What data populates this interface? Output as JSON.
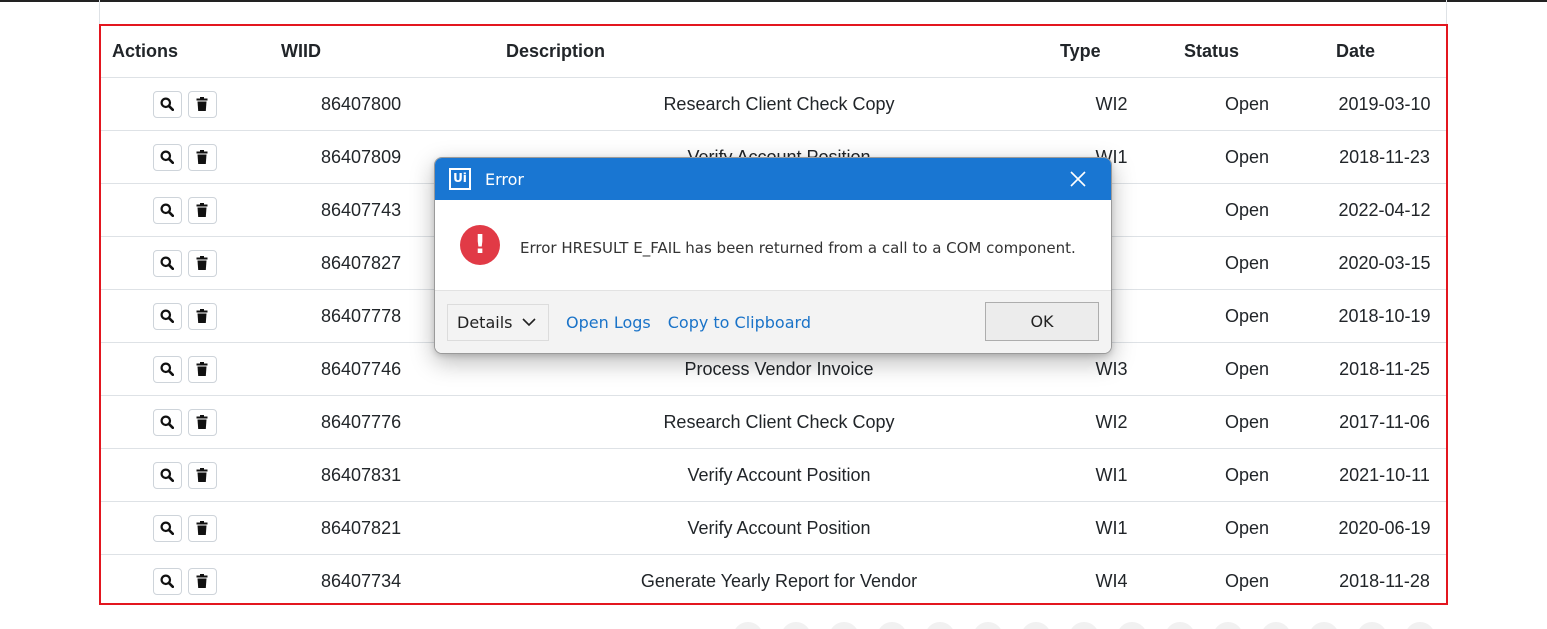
{
  "table": {
    "headers": {
      "actions": "Actions",
      "wiid": "WIID",
      "description": "Description",
      "type": "Type",
      "status": "Status",
      "date": "Date"
    },
    "rows": [
      {
        "wiid": "86407800",
        "description": "Research Client Check Copy",
        "type": "WI2",
        "status": "Open",
        "date": "2019-03-10"
      },
      {
        "wiid": "86407809",
        "description": "Verify Account Position",
        "type": "WI1",
        "status": "Open",
        "date": "2018-11-23"
      },
      {
        "wiid": "86407743",
        "description": "",
        "type": "",
        "status": "Open",
        "date": "2022-04-12"
      },
      {
        "wiid": "86407827",
        "description": "",
        "type": "",
        "status": "Open",
        "date": "2020-03-15"
      },
      {
        "wiid": "86407778",
        "description": "",
        "type": "",
        "status": "Open",
        "date": "2018-10-19"
      },
      {
        "wiid": "86407746",
        "description": "Process Vendor Invoice",
        "type": "WI3",
        "status": "Open",
        "date": "2018-11-25"
      },
      {
        "wiid": "86407776",
        "description": "Research Client Check Copy",
        "type": "WI2",
        "status": "Open",
        "date": "2017-11-06"
      },
      {
        "wiid": "86407831",
        "description": "Verify Account Position",
        "type": "WI1",
        "status": "Open",
        "date": "2021-10-11"
      },
      {
        "wiid": "86407821",
        "description": "Verify Account Position",
        "type": "WI1",
        "status": "Open",
        "date": "2020-06-19"
      },
      {
        "wiid": "86407734",
        "description": "Generate Yearly Report for Vendor",
        "type": "WI4",
        "status": "Open",
        "date": "2018-11-28"
      }
    ],
    "row_actions": {
      "view_icon": "search-icon",
      "delete_icon": "trash-icon"
    },
    "highlight_color": "#e3161f"
  },
  "dialog": {
    "logo_text": "Ui",
    "title": "Error",
    "message": "Error HRESULT E_FAIL has been returned from a call to a COM component.",
    "icon": "error-icon",
    "details_label": "Details",
    "open_logs_label": "Open Logs",
    "copy_label": "Copy to Clipboard",
    "ok_label": "OK",
    "title_bar_color": "#1976d2",
    "error_color": "#e13a46"
  }
}
